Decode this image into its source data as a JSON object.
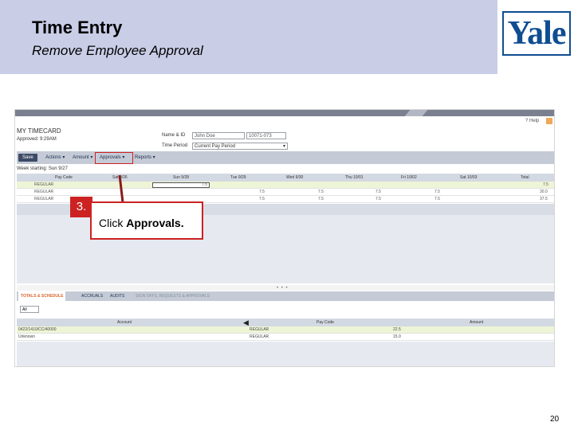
{
  "slide": {
    "title": "Time Entry",
    "subtitle": "Remove Employee Approval",
    "logo": "Yale",
    "page_number": "20"
  },
  "callout": {
    "step": "3.",
    "text_prefix": "Click ",
    "text_emphasis": "Approvals."
  },
  "timecard": {
    "title": "MY TIMECARD",
    "approved": "Approved: 9:29AM",
    "name_label": "Name & ID",
    "name_value": "John Doe",
    "id_value": "10071-073",
    "period_label": "Time Period",
    "period_value": "Current Pay Period",
    "help": "? Help",
    "toolbar": {
      "save": "Save",
      "actions": "Actions ▾",
      "amount": "Amount ▾",
      "approvals": "Approvals ▾",
      "reports": "Reports ▾"
    },
    "week_label": "Week starting: Sun 9/27",
    "columns": [
      "Pay Code",
      "Sat 9/26",
      "Sun 9/28",
      "Tue 9/29",
      "Wed 9/30",
      "Thu 10/01",
      "Fri 10/02",
      "Sat 10/03",
      "Total"
    ],
    "rows": [
      {
        "paycode": "REGULAR",
        "sun": "7.5",
        "tue": "",
        "wed": "",
        "thu": "",
        "fri": "",
        "sat": "",
        "total": "7.5"
      },
      {
        "paycode": "REGULAR",
        "sun": "",
        "tue": "7.5",
        "wed": "7.5",
        "thu": "7.5",
        "fri": "7.5",
        "sat": "",
        "total": "30.0"
      },
      {
        "paycode": "REGULAR",
        "sun": "",
        "tue": "7.5",
        "wed": "7.5",
        "thu": "7.5",
        "fri": "7.5",
        "sat": "",
        "total": "37.5"
      }
    ],
    "splitter": "• • •",
    "bottom_tabs": [
      "TOTALS & SCHEDULE",
      "ACCRUALS",
      "AUDITS",
      "SIGN OFFS, REQUESTS & APPROVALS"
    ],
    "filter": "All",
    "bottom_columns": [
      "Account",
      "Pay Code",
      "Amount"
    ],
    "bottom_rows": [
      {
        "account": "0422/1410/CC/40000",
        "paycode": "REGULAR",
        "amount": "22.5"
      },
      {
        "account": "Unknown",
        "paycode": "REGULAR",
        "amount": "15.0"
      }
    ]
  },
  "colors": {
    "header_band": "#c9cde6",
    "logo_blue": "#0f4d92",
    "callout_red": "#cc2222",
    "toolbar": "#c4cbd6",
    "active_tab": "#d9662d",
    "selected_row": "#eef5d6"
  }
}
